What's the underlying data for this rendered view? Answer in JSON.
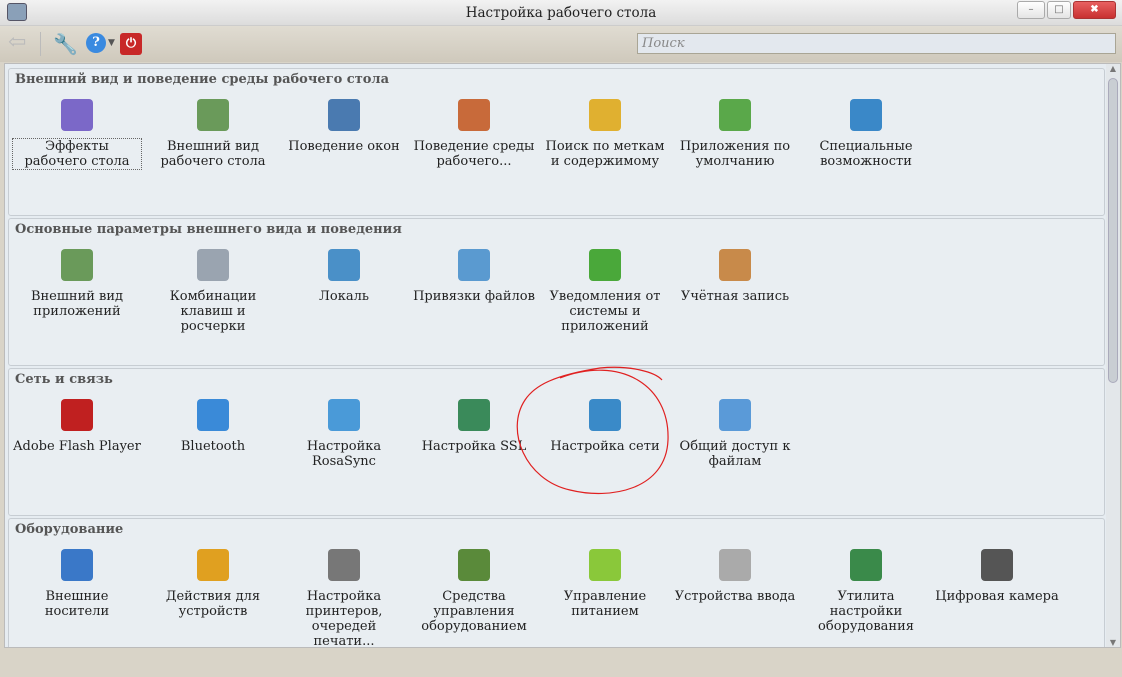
{
  "window": {
    "title": "Настройка рабочего стола",
    "minimize": "–",
    "maximize": "□",
    "close": "✖"
  },
  "toolbar": {
    "search_placeholder": "Поиск"
  },
  "sections": [
    {
      "title": "Внешний вид и поведение среды рабочего стола",
      "items": [
        {
          "label": "Эффекты рабочего стола",
          "icon": "desktop-effects-icon",
          "color": "#7b68c8"
        },
        {
          "label": "Внешний вид рабочего стола",
          "icon": "workspace-appearance-icon",
          "color": "#6a9a5a"
        },
        {
          "label": "Поведение окон",
          "icon": "window-behavior-icon",
          "color": "#4a7ab0"
        },
        {
          "label": "Поведение среды рабочего...",
          "icon": "workspace-behavior-icon",
          "color": "#c86a3a"
        },
        {
          "label": "Поиск по меткам и содержимому",
          "icon": "desktop-search-icon",
          "color": "#e0b030"
        },
        {
          "label": "Приложения по умолчанию",
          "icon": "default-apps-icon",
          "color": "#5aa84a"
        },
        {
          "label": "Специальные возможности",
          "icon": "accessibility-icon",
          "color": "#3a88c8"
        }
      ]
    },
    {
      "title": "Основные параметры внешнего вида и поведения",
      "items": [
        {
          "label": "Внешний вид приложений",
          "icon": "app-appearance-icon",
          "color": "#6a9a5a"
        },
        {
          "label": "Комбинации клавиш и росчерки",
          "icon": "shortcuts-icon",
          "color": "#9aa4b0"
        },
        {
          "label": "Локаль",
          "icon": "locale-icon",
          "color": "#4a90c8"
        },
        {
          "label": "Привязки файлов",
          "icon": "file-associations-icon",
          "color": "#5a9ad0"
        },
        {
          "label": "Уведомления от системы и приложений",
          "icon": "notifications-icon",
          "color": "#4aa83a"
        },
        {
          "label": "Учётная запись",
          "icon": "user-account-icon",
          "color": "#c88a4a"
        }
      ]
    },
    {
      "title": "Сеть и связь",
      "items": [
        {
          "label": "Adobe Flash Player",
          "icon": "flash-icon",
          "color": "#c02020"
        },
        {
          "label": "Bluetooth",
          "icon": "bluetooth-icon",
          "color": "#3a8ad8"
        },
        {
          "label": "Настройка RosaSync",
          "icon": "rosasync-icon",
          "color": "#4a9ad8"
        },
        {
          "label": "Настройка SSL",
          "icon": "ssl-icon",
          "color": "#3a8a5a"
        },
        {
          "label": "Настройка сети",
          "icon": "network-globe-icon",
          "color": "#3a8ac8"
        },
        {
          "label": "Общий доступ к файлам",
          "icon": "file-sharing-icon",
          "color": "#5a9ad8"
        }
      ]
    },
    {
      "title": "Оборудование",
      "items": [
        {
          "label": "Внешние носители",
          "icon": "removable-storage-icon",
          "color": "#3a78c8"
        },
        {
          "label": "Действия для устройств",
          "icon": "device-actions-icon",
          "color": "#e0a020"
        },
        {
          "label": "Настройка принтеров, очередей печати...",
          "icon": "printer-icon",
          "color": "#777"
        },
        {
          "label": "Средства управления оборудованием",
          "icon": "hardware-manager-icon",
          "color": "#5a8a3a"
        },
        {
          "label": "Управление питанием",
          "icon": "battery-icon",
          "color": "#8ac83a"
        },
        {
          "label": "Устройства ввода",
          "icon": "keyboard-icon",
          "color": "#aaa"
        },
        {
          "label": "Утилита настройки оборудования",
          "icon": "hardware-utility-icon",
          "color": "#3a8a4a"
        },
        {
          "label": "Цифровая камера",
          "icon": "camera-icon",
          "color": "#555"
        }
      ]
    }
  ]
}
